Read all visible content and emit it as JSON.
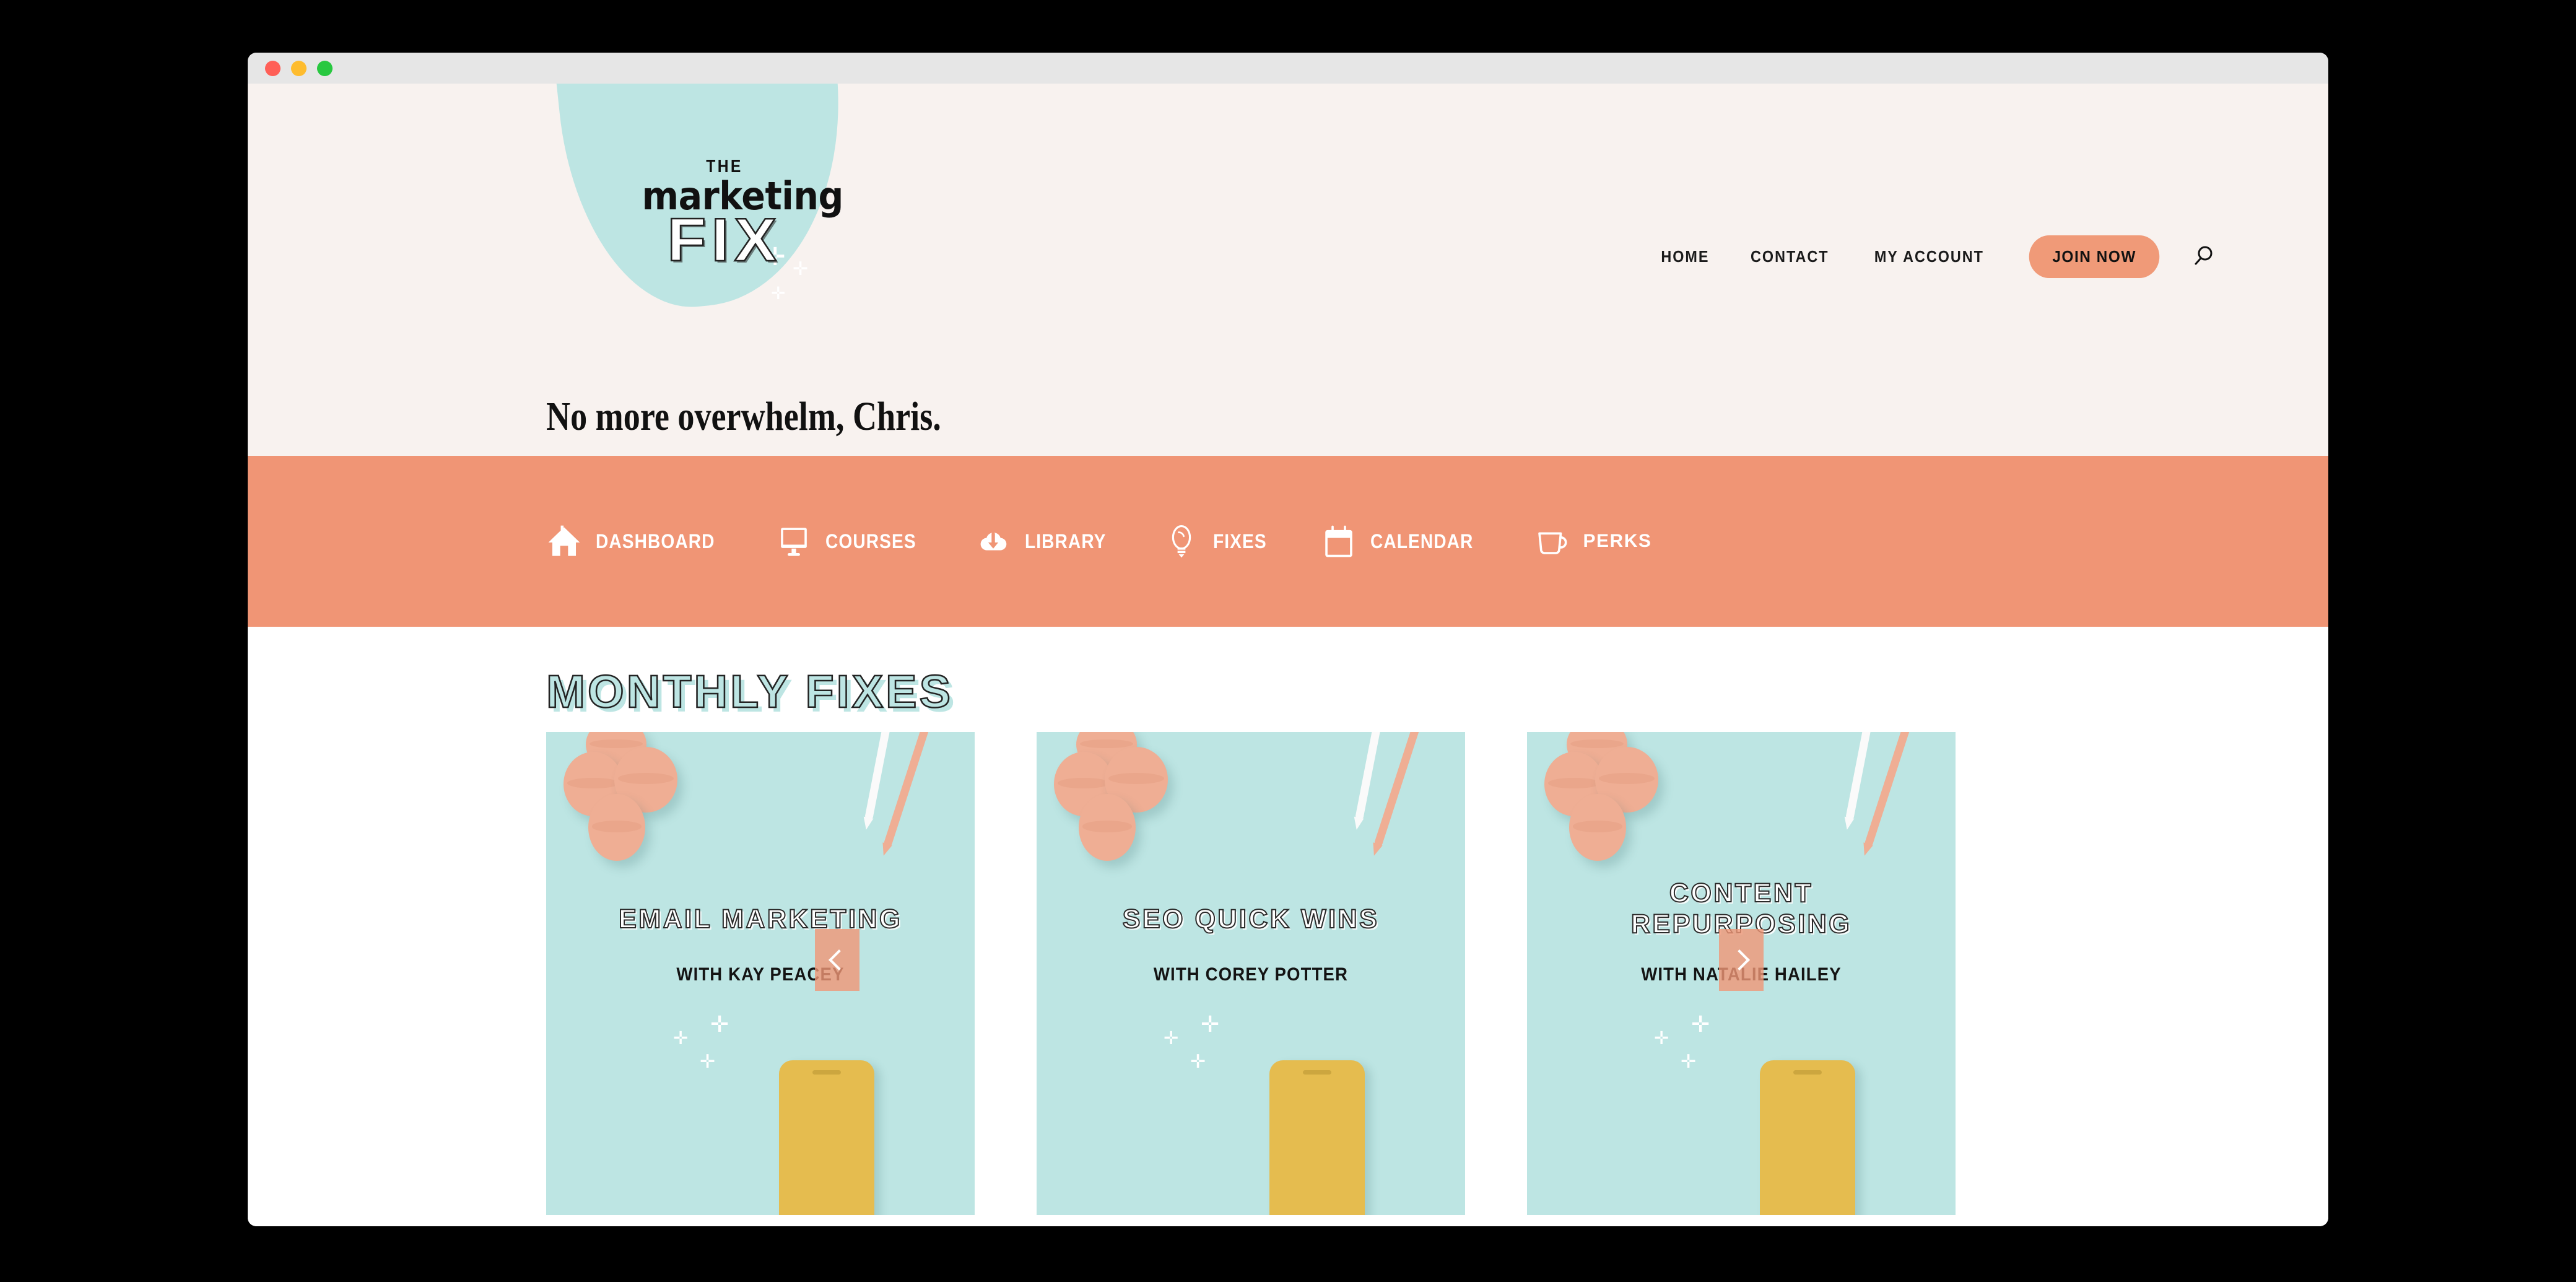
{
  "window": {
    "traffic_lights": [
      {
        "name": "close",
        "color": "#FF5F57"
      },
      {
        "name": "minimize",
        "color": "#FEBC2E"
      },
      {
        "name": "zoom",
        "color": "#28C840"
      }
    ]
  },
  "theme": {
    "cream": "#F8F2EF",
    "salmon": "#F09575",
    "salmon_button": "#F09A78",
    "mint": "#BDE5E3",
    "macaron": "#EFAE94",
    "phone_yellow": "#E5BC4F",
    "ink": "#111111"
  },
  "logo": {
    "the": "THE",
    "marketing": "marketing",
    "fix": "FIX"
  },
  "header": {
    "nav_links": [
      {
        "label": "HOME"
      },
      {
        "label": "CONTACT"
      },
      {
        "label": "MY ACCOUNT"
      }
    ],
    "join_now_label": "JOIN NOW",
    "search_icon": "search-icon",
    "greeting": "No more overwhelm, Chris."
  },
  "main_nav": {
    "items": [
      {
        "label": "DASHBOARD",
        "icon": "house-icon"
      },
      {
        "label": "COURSES",
        "icon": "monitor-icon"
      },
      {
        "label": "LIBRARY",
        "icon": "cloud-download-icon"
      },
      {
        "label": "FIXES",
        "icon": "lightbulb-icon"
      },
      {
        "label": "CALENDAR",
        "icon": "calendar-icon"
      },
      {
        "label": "PERKS",
        "icon": "coffee-cup-icon"
      }
    ]
  },
  "content": {
    "section_heading": "MONTHLY FIXES",
    "carousel": {
      "prev_label": "Previous",
      "next_label": "Next",
      "cards": [
        {
          "title": "EMAIL MARKETING",
          "title_lines": [
            "EMAIL MARKETING"
          ],
          "presenter": "WITH KAY PEACEY"
        },
        {
          "title": "SEO QUICK WINS",
          "title_lines": [
            "SEO QUICK WINS"
          ],
          "presenter": "WITH COREY POTTER"
        },
        {
          "title": "CONTENT REPURPOSING",
          "title_lines": [
            "CONTENT",
            "REPURPOSING"
          ],
          "presenter": "WITH NATALIE HAILEY"
        }
      ]
    }
  }
}
